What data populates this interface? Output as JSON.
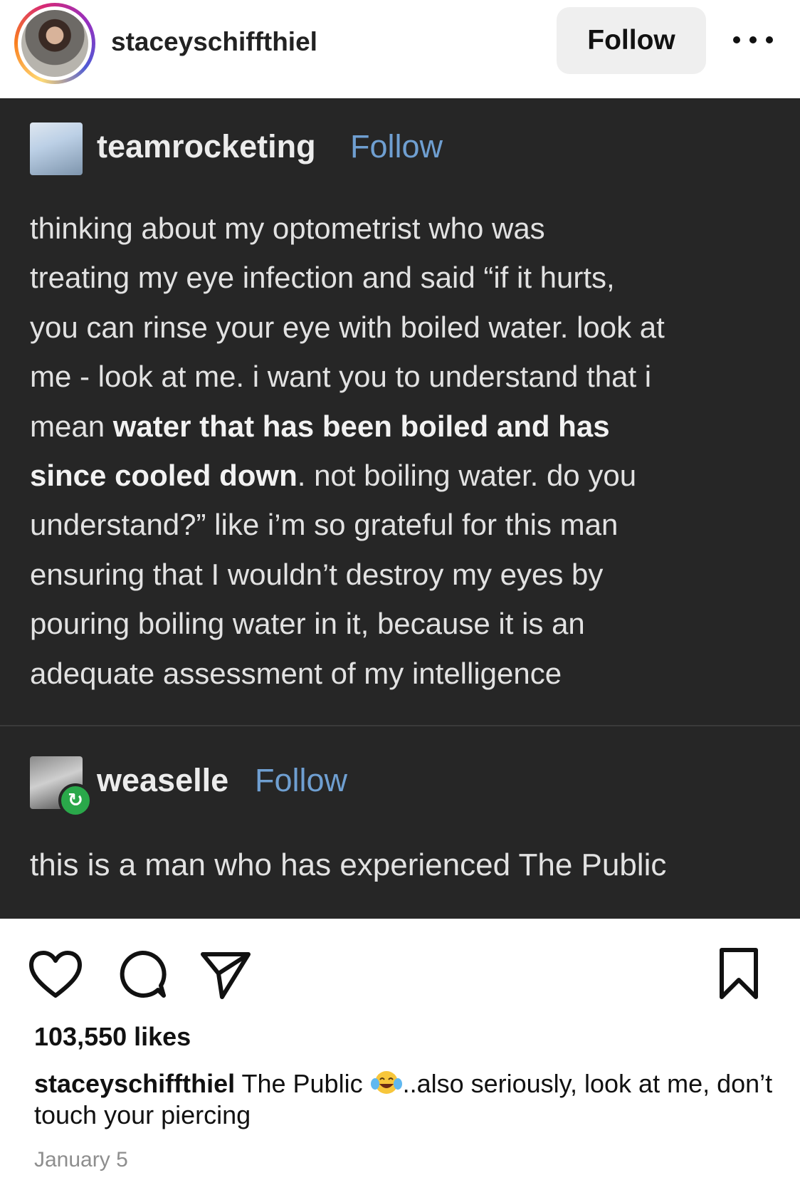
{
  "header": {
    "username": "staceyschiffthiel",
    "follow_label": "Follow",
    "more_icon": "more-horizontal-icon"
  },
  "post": {
    "original": {
      "blog_name": "teamrocketing",
      "follow_label": "Follow",
      "text_segments": [
        "thinking about my optometrist who was\ntreating my eye infection and said “if it hurts,\nyou can rinse your eye with boiled water. look at\nme - look at me. i want you to understand that i\nmean ",
        "water that has been boiled and has\nsince cooled down",
        ". not boiling water. do you\nunderstand?” like i’m so grateful for this man\nensuring that I wouldn’t destroy my eyes by\npouring boiling water in it, because it is an\nadequate assessment of my intelligence"
      ]
    },
    "reply": {
      "blog_name": "weaselle",
      "follow_label": "Follow",
      "text": "this is a man who has experienced The Public"
    }
  },
  "actions": {
    "icons": [
      "heart-icon",
      "comment-icon",
      "share-icon",
      "bookmark-icon"
    ],
    "likes": "103,550 likes",
    "caption_user": "staceyschiffthiel",
    "caption_text_before_emoji": " The Public ",
    "caption_emoji": "face-with-tears-of-joy-icon",
    "caption_text_after_emoji": "..also seriously, look at me, don’t touch your piercing",
    "date": "January 5"
  },
  "colors": {
    "post_background": "#262626",
    "tumblr_link": "#6f9fd1",
    "reblog_badge": "#2aa84a",
    "muted_text": "#8e8e8e"
  }
}
